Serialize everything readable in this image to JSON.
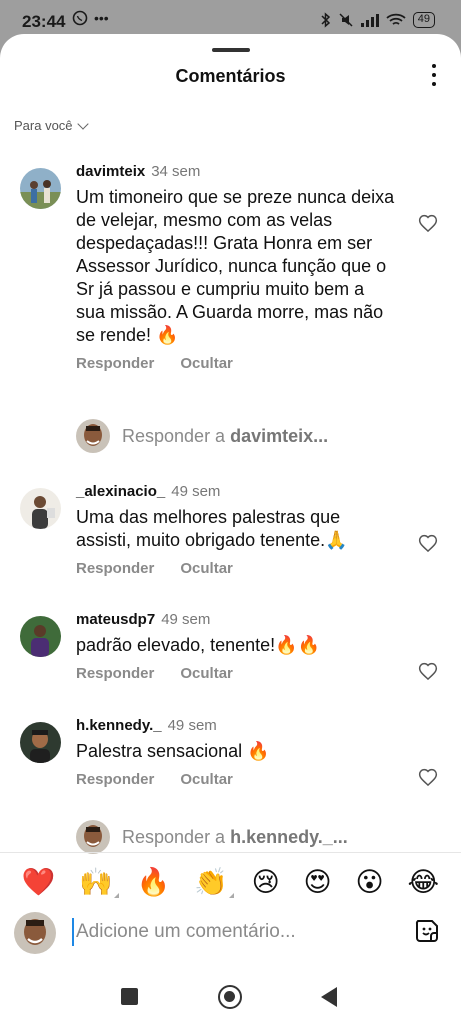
{
  "status_bar": {
    "time": "23:44",
    "left_icons": [
      "whatsapp-icon",
      "more-dots"
    ],
    "battery": "49"
  },
  "sheet": {
    "title": "Comentários",
    "sort_label": "Para você"
  },
  "comments": [
    {
      "user": "davimteix",
      "time": "34 sem",
      "text": "Um timoneiro que se preze nunca deixa de velejar, mesmo com as velas despedaçadas!!! Grata Honra em ser Assessor Jurídico, nunca função que o Sr já passou e cumpriu muito bem a sua missão. A Guarda morre, mas não se rende! 🔥",
      "reply": "Responder",
      "hide": "Ocultar"
    },
    {
      "user": "_alexinacio_",
      "time": "49 sem",
      "text": "Uma das melhores palestras que assisti, muito obrigado tenente.🙏",
      "reply": "Responder",
      "hide": "Ocultar"
    },
    {
      "user": "mateusdp7",
      "time": "49 sem",
      "text": "padrão elevado, tenente!🔥🔥",
      "reply": "Responder",
      "hide": "Ocultar"
    },
    {
      "user": "h.kennedy._",
      "time": "49 sem",
      "text": "Palestra sensacional 🔥",
      "reply": "Responder",
      "hide": "Ocultar"
    }
  ],
  "reply_prompts": [
    {
      "prefix": "Responder a ",
      "user": "davimteix..."
    },
    {
      "prefix": "Responder a ",
      "user": "h.kennedy._..."
    }
  ],
  "emoji_bar": [
    "❤️",
    "🙌",
    "🔥",
    "👏",
    "😢",
    "😍",
    "😮",
    "😂"
  ],
  "composer": {
    "placeholder": "Adicione um comentário..."
  },
  "colors": {
    "accent_cursor": "#1e88e5",
    "muted_text": "#8a8a8a",
    "scrim": "#9e9e9e"
  }
}
